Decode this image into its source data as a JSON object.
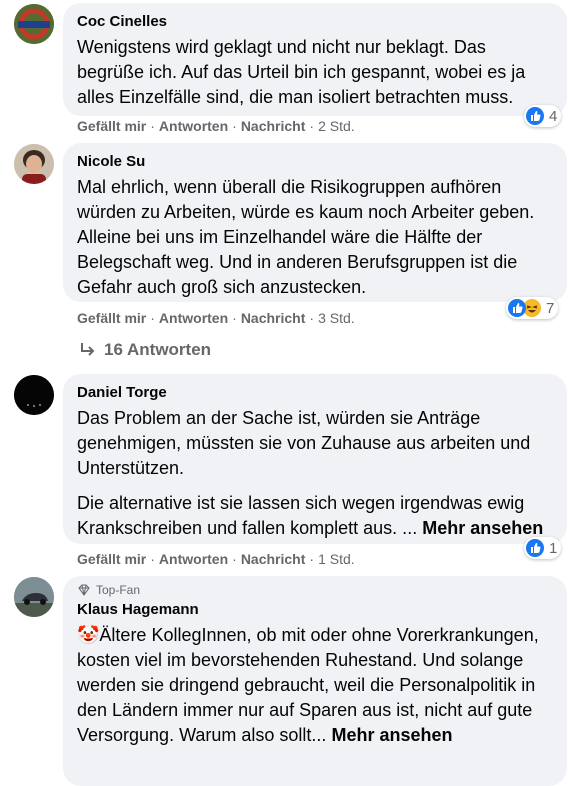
{
  "comments": [
    {
      "author": "Coc Cinelles",
      "text": "Wenigstens wird geklagt und nicht nur beklagt. Das begrüße ich. Auf das Urteil bin ich gespannt, wobei es ja alles Einzelfälle sind, die man isoliert betrachten muss.",
      "reaction_count": "4",
      "time": "2 Std."
    },
    {
      "author": "Nicole Su",
      "text": "Mal ehrlich, wenn überall die Risikogruppen aufhören würden zu Arbeiten, würde es kaum noch Arbeiter geben. Alleine bei uns im Einzelhandel wäre die Hälfte der Belegschaft weg. Und in anderen Berufsgruppen ist die Gefahr auch groß sich anzustecken.",
      "reaction_count": "7",
      "time": "3 Std.",
      "replies_label": "16 Antworten"
    },
    {
      "author": "Daniel Torge",
      "text": "Das Problem an der Sache ist, würden sie Anträge genehmigen, müssten sie von Zuhause aus arbeiten und Unterstützen.",
      "text2": "Die alternative ist sie lassen sich wegen irgendwas ewig Krankschreiben und fallen komplett aus. ...",
      "more": "Mehr ansehen",
      "reaction_count": "1",
      "time": "1 Std."
    },
    {
      "badge": "Top-Fan",
      "author": "Klaus Hagemann",
      "emoji": "🤡",
      "text": "Ältere KollegInnen, ob mit oder ohne Vorerkrankungen, kosten viel im bevorstehenden Ruhestand. Und solange werden sie dringend gebraucht, weil die Personalpolitik in den Ländern immer nur auf Sparen aus ist, nicht auf gute Versorgung. Warum also sollt...",
      "more": "Mehr ansehen"
    }
  ],
  "actions": {
    "like": "Gefällt mir",
    "reply": "Antworten",
    "message": "Nachricht",
    "sep": "·"
  },
  "icons": {
    "like": "thumbs-up-icon",
    "haha": "laughing-face-icon",
    "reply_arrow": "reply-arrow-icon",
    "top_fan": "diamond-icon"
  },
  "colors": {
    "like_blue": "#1877f2",
    "haha_yellow": "#f7b928",
    "bubble": "#f0f2f5",
    "meta": "#65676b"
  }
}
